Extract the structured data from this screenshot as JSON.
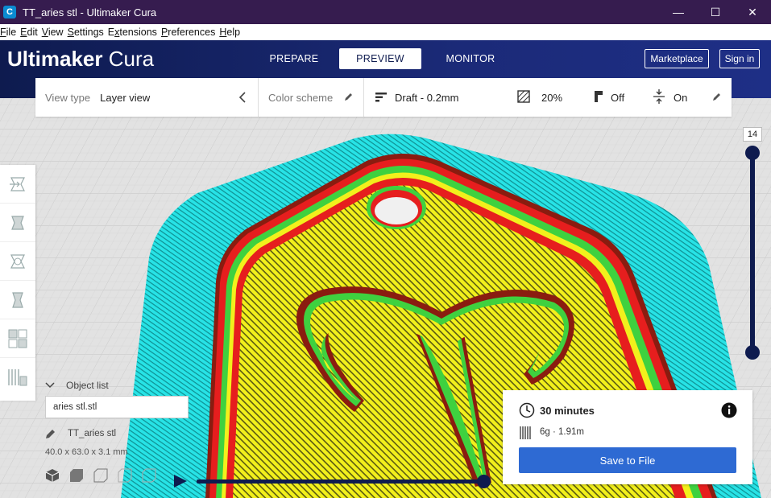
{
  "window": {
    "title": "TT_aries stl - Ultimaker Cura",
    "app_icon": "C",
    "minimize": "—",
    "maximize": "☐",
    "close": "✕"
  },
  "menu": [
    {
      "accel": "F",
      "rest": "ile"
    },
    {
      "accel": "E",
      "rest": "dit"
    },
    {
      "accel": "V",
      "rest": "iew"
    },
    {
      "accel": "S",
      "rest": "ettings"
    },
    {
      "accel": "x",
      "pre": "E",
      "rest": "tensions"
    },
    {
      "accel": "P",
      "rest": "references"
    },
    {
      "accel": "H",
      "rest": "elp"
    }
  ],
  "header": {
    "logo_bold": "Ultimaker",
    "logo_light": "Cura",
    "tabs": [
      "PREPARE",
      "PREVIEW",
      "MONITOR"
    ],
    "active_tab": "PREVIEW",
    "marketplace": "Marketplace",
    "signin": "Sign in",
    "colors": {
      "header": "#1b2a78",
      "titlebar": "#361c4f"
    }
  },
  "viewbar": {
    "view_type_label": "View type",
    "view_type_value": "Layer view",
    "color_scheme_label": "Color scheme",
    "profile": "Draft - 0.2mm",
    "infill": "20%",
    "support": "Off",
    "adhesion": "On"
  },
  "layer_slider": {
    "value": "14"
  },
  "object_list": {
    "title": "Object list",
    "item": "aries stl.stl",
    "object_name": "TT_aries stl",
    "dimensions": "40.0 x 63.0 x 3.1 mm"
  },
  "print_info": {
    "time": "30 minutes",
    "material": "6g · 1.91m",
    "save": "Save to File",
    "accent": "#2e6ad3"
  },
  "scene_colors": {
    "skirt": "#27e3e6",
    "wall_outer": "#e61e1e",
    "wall_inner": "#3fd13f",
    "infill": "#f2f01c"
  }
}
